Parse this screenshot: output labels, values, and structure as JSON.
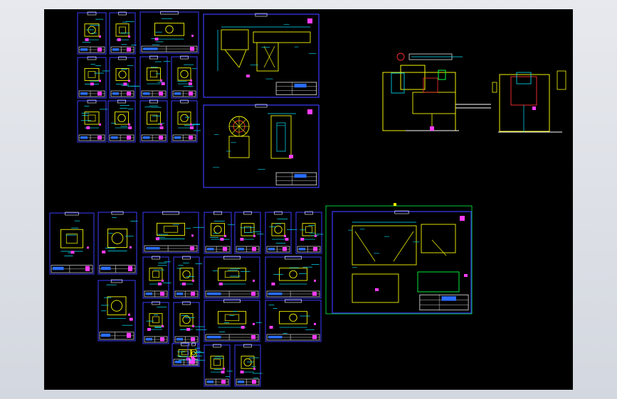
{
  "viewer": {
    "background": "#000000",
    "frame_color": "#dcdfe6"
  },
  "palette": {
    "sheet_border": "#3b3bff",
    "title_block": "#ffffff",
    "part_line": "#f5f500",
    "dim_line": "#00e5ff",
    "note": "#ff3cff",
    "accent_red": "#ff3030",
    "accent_green": "#00ff40"
  },
  "drawing": {
    "type": "cad-sheet-overview",
    "zoom_hint": "fit-all"
  }
}
